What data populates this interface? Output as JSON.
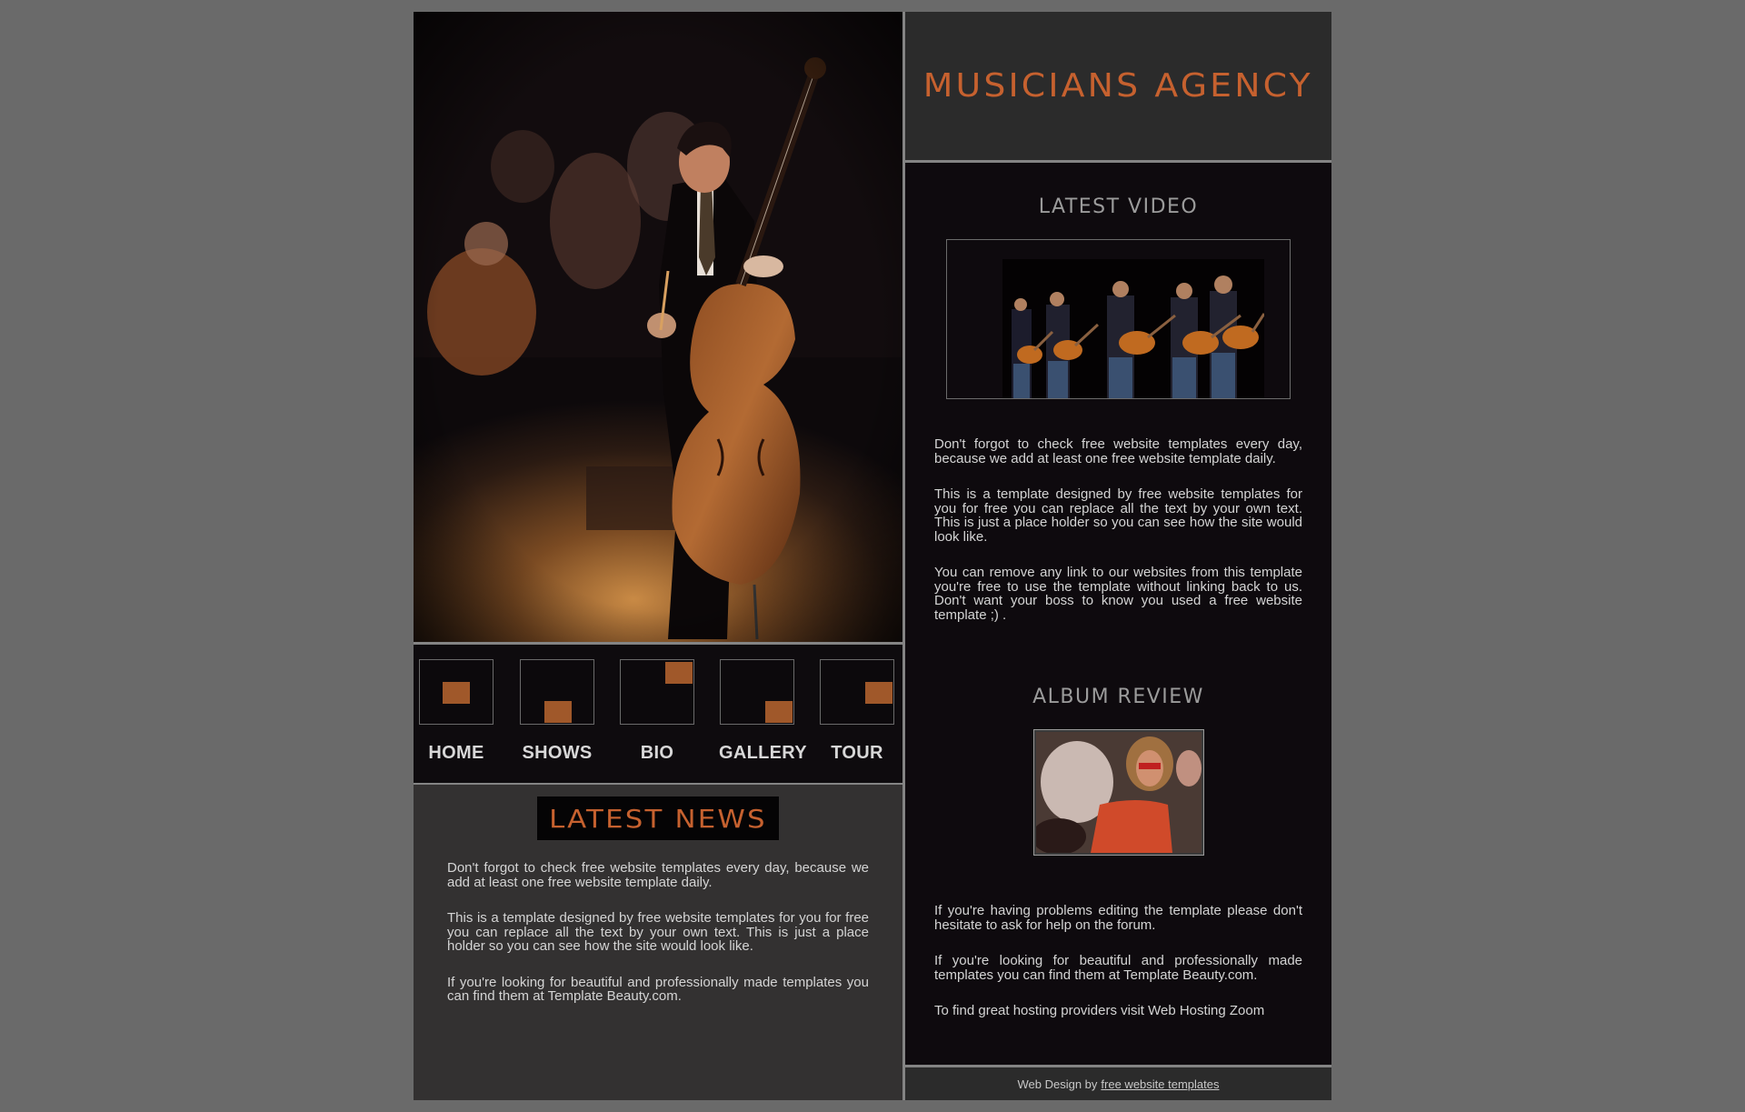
{
  "header": {
    "site_title": "MUSICIANS AGENCY"
  },
  "nav": {
    "items": [
      {
        "label": "HOME"
      },
      {
        "label": "SHOWS"
      },
      {
        "label": "BIO"
      },
      {
        "label": "GALLERY"
      },
      {
        "label": "TOUR"
      }
    ]
  },
  "news": {
    "title": "LATEST NEWS",
    "paragraphs": [
      "Don't forgot to check free website templates every day, because we add at least one free website template daily.",
      "This is a template designed by free website templates for you for free you can replace all the text by your own text. This is just a place holder so you can see how the site would look like.",
      "If you're looking for beautiful and professionally made templates you can find them at Template Beauty.com."
    ]
  },
  "video": {
    "title": "LATEST VIDEO",
    "paragraphs": [
      "Don't forgot to check free website templates every day, because we add at least one free website template daily.",
      "This is a template designed by free website templates for you for free you can replace all the text by your own text. This is just a place holder so you can see how the site would look like.",
      "You can remove any link to our websites from this template you're free to use the template without linking back to us. Don't want your boss to know you used a free website template ;) ."
    ]
  },
  "album": {
    "title": "ALBUM REVIEW",
    "paragraphs": [
      "If you're having problems editing the template please don't hesitate to ask for help on the forum.",
      "If you're looking for beautiful and professionally made templates you can find them at Template Beauty.com.",
      "To find great hosting providers visit Web Hosting Zoom"
    ]
  },
  "footer": {
    "prefix": "Web Design by",
    "link_label": "free website templates"
  },
  "colors": {
    "accent": "#c6612f",
    "nav_square": "#a0582a",
    "page_bg": "#6a6a6a"
  }
}
